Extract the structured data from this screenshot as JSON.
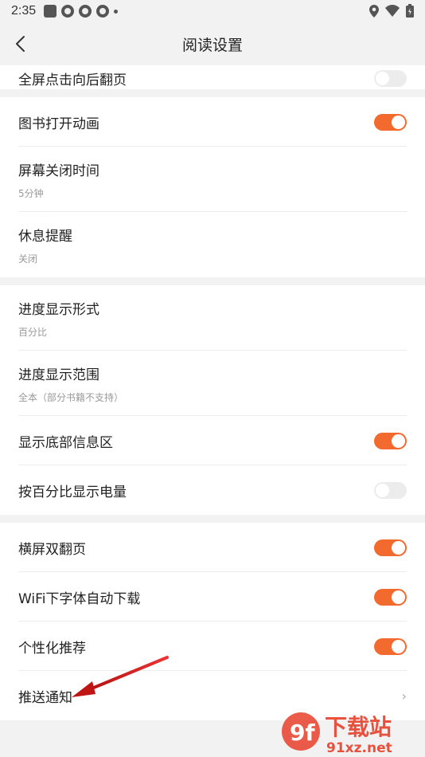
{
  "status_bar": {
    "time": "2:35"
  },
  "nav": {
    "title": "阅读设置"
  },
  "top_partial": {
    "label": "全屏点击向后翻页"
  },
  "groups": [
    {
      "rows": [
        {
          "label": "图书打开动画",
          "sub": "",
          "control": "toggle",
          "on": true
        },
        {
          "label": "屏幕关闭时间",
          "sub": "5分钟",
          "control": "none"
        },
        {
          "label": "休息提醒",
          "sub": "关闭",
          "control": "none"
        }
      ]
    },
    {
      "rows": [
        {
          "label": "进度显示形式",
          "sub": "百分比",
          "control": "none"
        },
        {
          "label": "进度显示范围",
          "sub": "全本（部分书籍不支持）",
          "control": "none"
        },
        {
          "label": "显示底部信息区",
          "sub": "",
          "control": "toggle",
          "on": true
        },
        {
          "label": "按百分比显示电量",
          "sub": "",
          "control": "toggle",
          "on": false
        }
      ]
    },
    {
      "rows": [
        {
          "label": "横屏双翻页",
          "sub": "",
          "control": "toggle",
          "on": true
        },
        {
          "label": "WiFi下字体自动下载",
          "sub": "",
          "control": "toggle",
          "on": true
        },
        {
          "label": "个性化推荐",
          "sub": "",
          "control": "toggle",
          "on": true
        },
        {
          "label": "推送通知",
          "sub": "",
          "control": "chevron",
          "chevron": "›"
        }
      ]
    }
  ],
  "watermark": {
    "logo_text": "9f",
    "site_name": "下载站",
    "domain": "91xz.net"
  },
  "colors": {
    "accent": "#f26a2e",
    "arrow": "#d42020"
  }
}
